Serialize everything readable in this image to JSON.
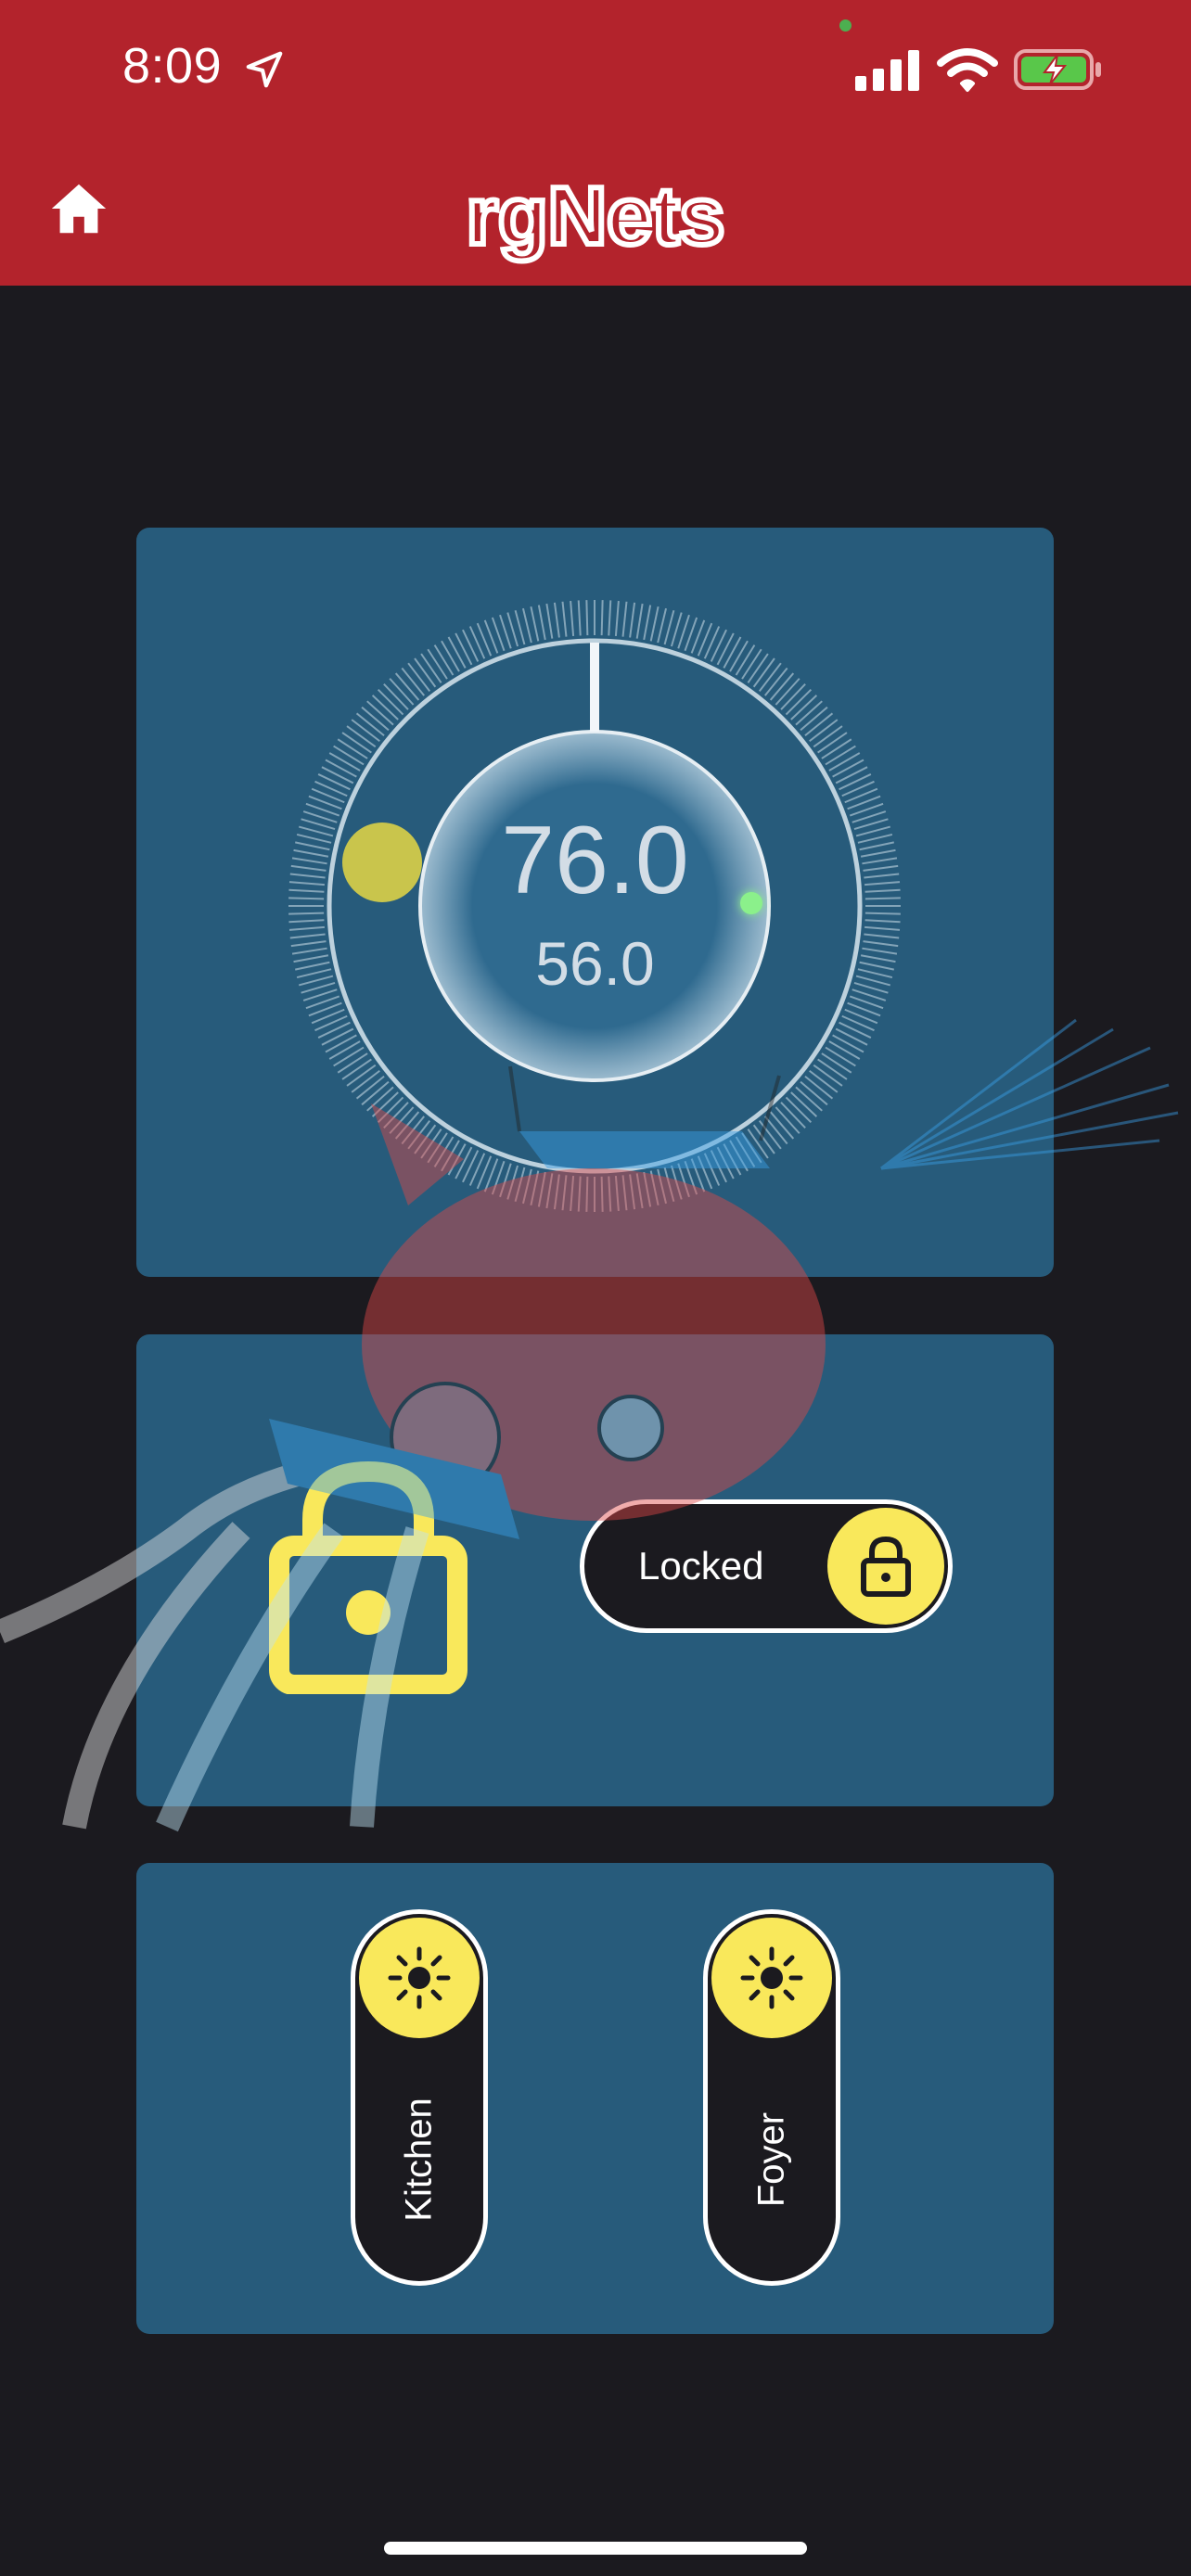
{
  "status_bar": {
    "time": "8:09",
    "icons": [
      "location-arrow-icon",
      "signal-bars-icon",
      "wifi-icon",
      "battery-charging-icon"
    ]
  },
  "header": {
    "logo_text": "rgNets",
    "home_icon": "home-icon",
    "background_color": "#b3232c"
  },
  "thermostat": {
    "current_temp": "76.0",
    "setpoint_temp": "56.0",
    "heat_marker_color": "#c9c54c",
    "cool_marker_color": "#8bf08b"
  },
  "lock": {
    "icon": "padlock-icon",
    "state_label": "Locked",
    "toggle_icon": "lock-icon",
    "accent_color": "#f9e85b"
  },
  "lights": [
    {
      "label": "Kitchen",
      "icon": "sun-icon"
    },
    {
      "label": "Foyer",
      "icon": "sun-icon"
    }
  ],
  "colors": {
    "background": "#1b1a1f",
    "card": "#275b7b",
    "accent": "#f9e85b"
  }
}
